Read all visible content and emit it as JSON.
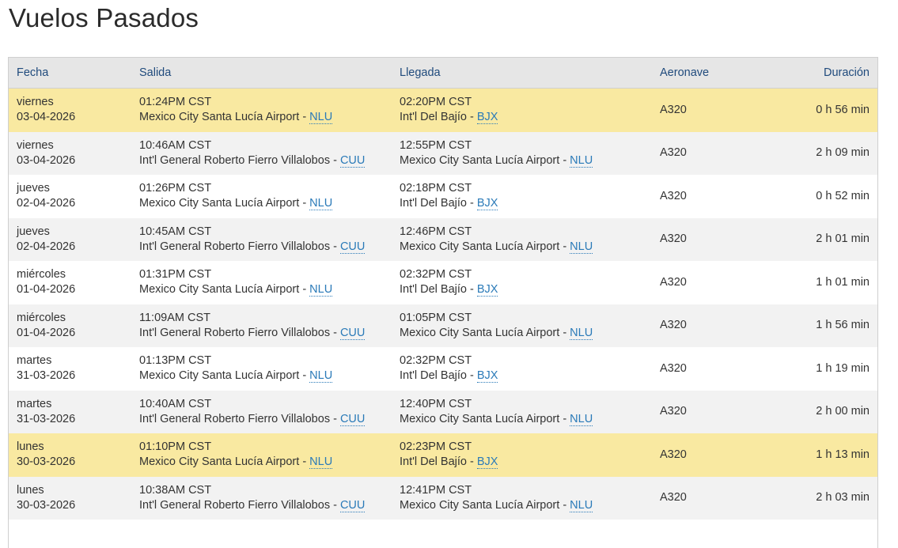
{
  "page": {
    "title": "Vuelos Pasados"
  },
  "table": {
    "headers": {
      "fecha": "Fecha",
      "salida": "Salida",
      "llegada": "Llegada",
      "aeronave": "Aeronave",
      "duracion": "Duración"
    },
    "rows": [
      {
        "day": "viernes",
        "date": "03-04-2026",
        "dep_time": "01:24PM CST",
        "dep_airport": "Mexico City Santa Lucía Airport - ",
        "dep_code": "NLU",
        "arr_time": "02:20PM CST",
        "arr_airport": "Int'l Del Bajío - ",
        "arr_code": "BJX",
        "aircraft": "A320",
        "duration": "0 h 56 min",
        "highlight": true
      },
      {
        "day": "viernes",
        "date": "03-04-2026",
        "dep_time": "10:46AM CST",
        "dep_airport": "Int'l General Roberto Fierro Villalobos - ",
        "dep_code": "CUU",
        "arr_time": "12:55PM CST",
        "arr_airport": "Mexico City Santa Lucía Airport - ",
        "arr_code": "NLU",
        "aircraft": "A320",
        "duration": "2 h 09 min",
        "highlight": false
      },
      {
        "day": "jueves",
        "date": "02-04-2026",
        "dep_time": "01:26PM CST",
        "dep_airport": "Mexico City Santa Lucía Airport - ",
        "dep_code": "NLU",
        "arr_time": "02:18PM CST",
        "arr_airport": "Int'l Del Bajío - ",
        "arr_code": "BJX",
        "aircraft": "A320",
        "duration": "0 h 52 min",
        "highlight": false
      },
      {
        "day": "jueves",
        "date": "02-04-2026",
        "dep_time": "10:45AM CST",
        "dep_airport": "Int'l General Roberto Fierro Villalobos - ",
        "dep_code": "CUU",
        "arr_time": "12:46PM CST",
        "arr_airport": "Mexico City Santa Lucía Airport - ",
        "arr_code": "NLU",
        "aircraft": "A320",
        "duration": "2 h 01 min",
        "highlight": false
      },
      {
        "day": "miércoles",
        "date": "01-04-2026",
        "dep_time": "01:31PM CST",
        "dep_airport": "Mexico City Santa Lucía Airport - ",
        "dep_code": "NLU",
        "arr_time": "02:32PM CST",
        "arr_airport": "Int'l Del Bajío - ",
        "arr_code": "BJX",
        "aircraft": "A320",
        "duration": "1 h 01 min",
        "highlight": false
      },
      {
        "day": "miércoles",
        "date": "01-04-2026",
        "dep_time": "11:09AM CST",
        "dep_airport": "Int'l General Roberto Fierro Villalobos - ",
        "dep_code": "CUU",
        "arr_time": "01:05PM CST",
        "arr_airport": "Mexico City Santa Lucía Airport - ",
        "arr_code": "NLU",
        "aircraft": "A320",
        "duration": "1 h 56 min",
        "highlight": false
      },
      {
        "day": "martes",
        "date": "31-03-2026",
        "dep_time": "01:13PM CST",
        "dep_airport": "Mexico City Santa Lucía Airport - ",
        "dep_code": "NLU",
        "arr_time": "02:32PM CST",
        "arr_airport": "Int'l Del Bajío - ",
        "arr_code": "BJX",
        "aircraft": "A320",
        "duration": "1 h 19 min",
        "highlight": false
      },
      {
        "day": "martes",
        "date": "31-03-2026",
        "dep_time": "10:40AM CST",
        "dep_airport": "Int'l General Roberto Fierro Villalobos - ",
        "dep_code": "CUU",
        "arr_time": "12:40PM CST",
        "arr_airport": "Mexico City Santa Lucía Airport - ",
        "arr_code": "NLU",
        "aircraft": "A320",
        "duration": "2 h 00 min",
        "highlight": false
      },
      {
        "day": "lunes",
        "date": "30-03-2026",
        "dep_time": "01:10PM CST",
        "dep_airport": "Mexico City Santa Lucía Airport - ",
        "dep_code": "NLU",
        "arr_time": "02:23PM CST",
        "arr_airport": "Int'l Del Bajío - ",
        "arr_code": "BJX",
        "aircraft": "A320",
        "duration": "1 h 13 min",
        "highlight": true
      },
      {
        "day": "lunes",
        "date": "30-03-2026",
        "dep_time": "10:38AM CST",
        "dep_airport": "Int'l General Roberto Fierro Villalobos - ",
        "dep_code": "CUU",
        "arr_time": "12:41PM CST",
        "arr_airport": "Mexico City Santa Lucía Airport - ",
        "arr_code": "NLU",
        "aircraft": "A320",
        "duration": "2 h 03 min",
        "highlight": false
      }
    ]
  }
}
